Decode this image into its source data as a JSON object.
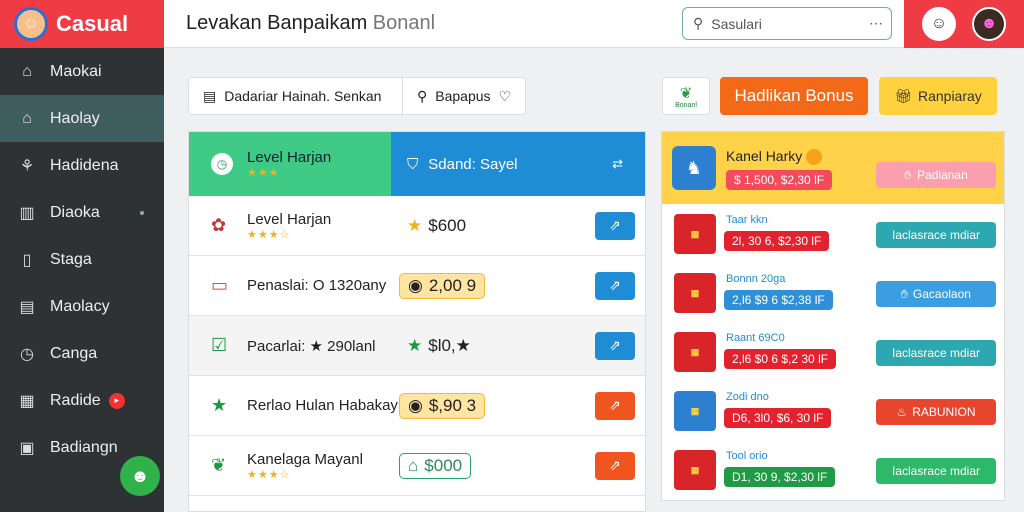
{
  "app": {
    "name": "Casual"
  },
  "sidebar": {
    "items": [
      {
        "label": "Maokai",
        "icon": "hanger-icon"
      },
      {
        "label": "Haolay",
        "icon": "home-icon"
      },
      {
        "label": "Hadidena",
        "icon": "tree-icon"
      },
      {
        "label": "Diaoka",
        "icon": "chart-icon"
      },
      {
        "label": "Staga",
        "icon": "document-icon"
      },
      {
        "label": "Maolacy",
        "icon": "card-icon"
      },
      {
        "label": "Canga",
        "icon": "clock-icon"
      },
      {
        "label": "Radide",
        "icon": "grid-icon"
      },
      {
        "label": "Badiangn",
        "icon": "image-icon"
      }
    ]
  },
  "header": {
    "title": "Levakan Banpaikam",
    "subtitle": "Bonanl"
  },
  "search": {
    "placeholder": "Sasulari"
  },
  "toolbar": {
    "segment_a": "Dadariar Hainah. Senkan",
    "segment_b": "Bapapus",
    "icon_button_label": "Bonanl",
    "bonus_button": "Hadlikan Bonus",
    "yellow_button": "Ranpiaray"
  },
  "table": {
    "header_left": "Level Harjan",
    "header_right": "Sdand: Sayel",
    "rows": [
      {
        "name": "Level Harjan",
        "value": "$600",
        "stars": "★★★☆"
      },
      {
        "name": "Penaslai: O 1320any",
        "value": "2,00 9",
        "stars": ""
      },
      {
        "name": "Pacarlai: ★ 290lanl",
        "value": "$l0,★",
        "stars": ""
      },
      {
        "name": "Rerlao Hulan Habakay",
        "value": "$,90 3",
        "stars": ""
      },
      {
        "name": "Kanelaga Mayanl",
        "value": "$000",
        "stars": "★★★☆"
      }
    ]
  },
  "bonus_panel": {
    "top": {
      "title": "Kanel Harky",
      "price": "$ 1,500, $2,30 lF",
      "button": "Padianan"
    },
    "items": [
      {
        "name": "Taar kkn",
        "price": "2l, 30 6, $2,30 lF",
        "button": "Iaclasrace mdiar",
        "color": "#2ea8b0",
        "price_color": "#e2232e",
        "ticket": "#d9252a"
      },
      {
        "name": "Bonnn 20ga",
        "price": "2,l6 $9 6 $2,38 lF",
        "button": "Gacaolaon",
        "color": "#3a9ee0",
        "price_color": "#2f8fd8",
        "ticket": "#d9252a"
      },
      {
        "name": "Raant 69C0",
        "price": "2,l6 $0 6 $,2 30 lF",
        "button": "Iaclasrace mdiar",
        "color": "#2ea8b0",
        "price_color": "#e2232e",
        "ticket": "#d9252a"
      },
      {
        "name": "Zodi dno",
        "price": "D6, 3l0, $6, 30 lF",
        "button": "RABUNION",
        "color": "#e8452f",
        "price_color": "#e2232e",
        "ticket": "#2d7fd0"
      },
      {
        "name": "Tool orio",
        "price": "D1, 30 9, $2,30 lF",
        "button": "Iaclasrace mdiar",
        "color": "#2db86a",
        "price_color": "#1f9a45",
        "ticket": "#d9252a"
      }
    ]
  }
}
